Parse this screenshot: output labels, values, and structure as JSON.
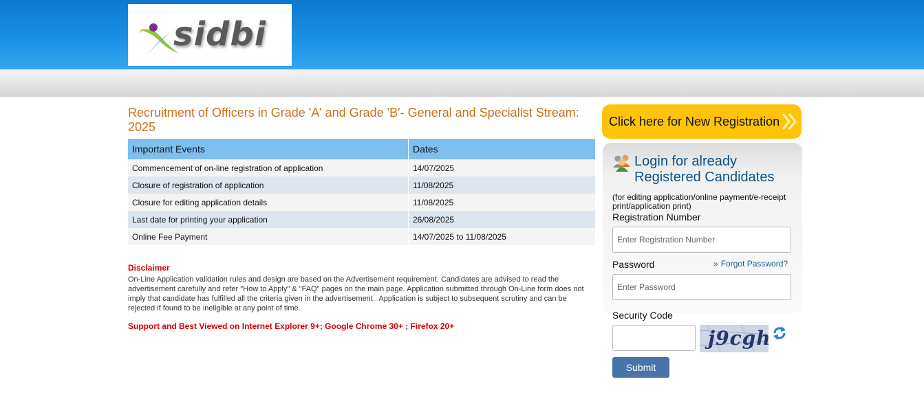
{
  "header": {
    "logo_text": "sidbi"
  },
  "main": {
    "title": "Recruitment of Officers in Grade 'A' and Grade 'B'- General and Specialist Stream: 2025",
    "table": {
      "headers": [
        "Important Events",
        "Dates"
      ],
      "rows": [
        [
          "Commencement of on-line registration of application",
          "14/07/2025"
        ],
        [
          "Closure of registration of application",
          "11/08/2025"
        ],
        [
          "Closure for editing application details",
          "11/08/2025"
        ],
        [
          "Last date for printing your application",
          "26/08/2025"
        ],
        [
          "Online Fee Payment",
          "14/07/2025 to 11/08/2025"
        ]
      ]
    },
    "disclaimer_title": "Disclaimer",
    "disclaimer_text": "On-Line Application validation rules and design are based on the Advertisement requirement. Candidates are advised to read the advertisement carefully and refer \"How to Apply\" & \"FAQ\" pages on the main page. Application submitted through On-Line form does not imply that candidate has fulfilled all the criteria given in the advertisement . Application is subject to subsequent scrutiny and can be rejected if found to be ineligible at any point of time.",
    "support_text": "Support and Best Viewed on Internet Explorer 9+; Google Chrome 30+ ; Firefox 20+"
  },
  "sidebar": {
    "new_registration_label": "Click here for New Registration",
    "login_title": "Login for already Registered Candidates",
    "login_subtitle": "(for editing application/online payment/e-receipt print/application print)",
    "registration_label": "Registration Number",
    "registration_placeholder": "Enter Registration Number",
    "password_label": "Password",
    "password_placeholder": "Enter Password",
    "forgot_label": "Forgot Password?",
    "security_label": "Security Code",
    "captcha_text": "j9cgh",
    "submit_label": "Submit"
  },
  "colors": {
    "header_blue": "#1b93e6",
    "title_orange": "#c8731a",
    "accent_yellow": "#ffc40a",
    "disclaimer_red": "#d40000",
    "submit_blue": "#4a74a8"
  },
  "icons": [
    "sidbi-logo",
    "users-icon",
    "double-chevron-icon",
    "refresh-icon"
  ]
}
